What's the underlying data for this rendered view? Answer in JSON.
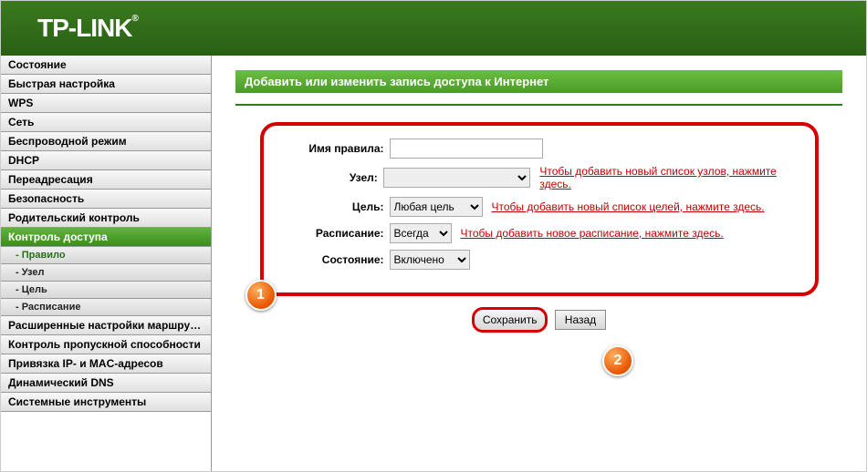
{
  "brand": "TP-LINK",
  "sidebar": {
    "items": [
      {
        "label": "Состояние"
      },
      {
        "label": "Быстрая настройка"
      },
      {
        "label": "WPS"
      },
      {
        "label": "Сеть"
      },
      {
        "label": "Беспроводной режим"
      },
      {
        "label": "DHCP"
      },
      {
        "label": "Переадресация"
      },
      {
        "label": "Безопасность"
      },
      {
        "label": "Родительский контроль"
      },
      {
        "label": "Контроль доступа",
        "active": true,
        "sub": [
          {
            "label": "- Правило",
            "active": true
          },
          {
            "label": "- Узел"
          },
          {
            "label": "- Цель"
          },
          {
            "label": "- Расписание"
          }
        ]
      },
      {
        "label": "Расширенные настройки маршрутизации"
      },
      {
        "label": "Контроль пропускной способности"
      },
      {
        "label": "Привязка IP- и MAC-адресов"
      },
      {
        "label": "Динамический DNS"
      },
      {
        "label": "Системные инструменты"
      }
    ]
  },
  "page_title": "Добавить или изменить запись доступа к Интернет",
  "form": {
    "rule_name": {
      "label": "Имя правила:",
      "value": ""
    },
    "host": {
      "label": "Узел:",
      "value": "",
      "link": "Чтобы добавить новый список узлов, нажмите здесь."
    },
    "target": {
      "label": "Цель:",
      "value": "Любая цель",
      "link": "Чтобы добавить новый список целей, нажмите здесь."
    },
    "schedule": {
      "label": "Расписание:",
      "value": "Всегда",
      "link": "Чтобы добавить новое расписание, нажмите здесь."
    },
    "state": {
      "label": "Состояние:",
      "value": "Включено"
    }
  },
  "buttons": {
    "save": "Сохранить",
    "back": "Назад"
  },
  "markers": {
    "m1": "1",
    "m2": "2"
  }
}
